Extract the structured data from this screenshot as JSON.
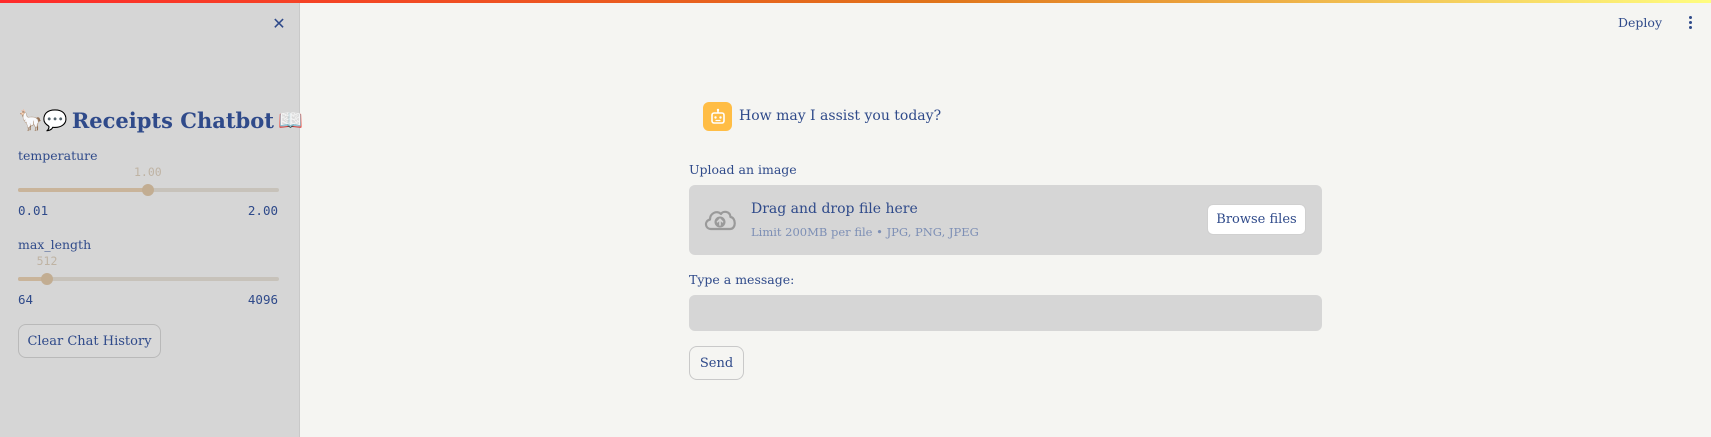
{
  "colors": {
    "accent": "#2f4a8a",
    "sidebar_bg": "#d6d6d6",
    "main_bg": "#f5f5f2",
    "avatar_bg": "#ffbd45",
    "slider_fill": "#c9b49a"
  },
  "sidebar": {
    "close_icon": "close-icon",
    "title_prefix": "🦙💬",
    "title_text": "Receipts Chatbot",
    "title_suffix": "📖",
    "sliders": [
      {
        "label": "temperature",
        "value_text": "1.00",
        "value": 1.0,
        "min": 0.01,
        "max": 2.0,
        "min_text": "0.01",
        "max_text": "2.00"
      },
      {
        "label": "max_length",
        "value_text": "512",
        "value": 512,
        "min": 64,
        "max": 4096,
        "min_text": "64",
        "max_text": "4096"
      }
    ],
    "clear_button": "Clear Chat History"
  },
  "header": {
    "deploy_label": "Deploy",
    "menu_icon": "kebab-menu-icon"
  },
  "chat": {
    "avatar_icon": "bot-icon",
    "assistant_message": "How may I assist you today?"
  },
  "uploader": {
    "label": "Upload an image",
    "icon": "cloud-upload-icon",
    "title": "Drag and drop file here",
    "subtitle": "Limit 200MB per file • JPG, PNG, JPEG",
    "browse_label": "Browse files"
  },
  "message": {
    "label": "Type a message:",
    "value": "",
    "send_label": "Send"
  }
}
